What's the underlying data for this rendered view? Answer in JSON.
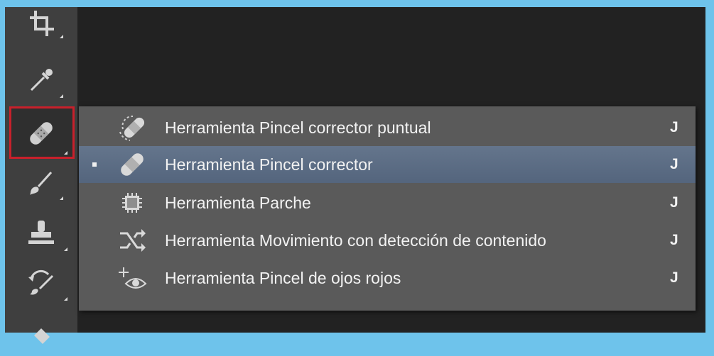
{
  "toolbar": {
    "tools": [
      {
        "name": "crop-tool"
      },
      {
        "name": "eyedropper-tool"
      },
      {
        "name": "healing-brush-tool",
        "active": true
      },
      {
        "name": "brush-tool"
      },
      {
        "name": "clone-stamp-tool"
      },
      {
        "name": "history-brush-tool"
      },
      {
        "name": "eraser-tool"
      }
    ]
  },
  "flyout": {
    "items": [
      {
        "label": "Herramienta Pincel corrector puntual",
        "shortcut": "J",
        "icon": "spot-healing-brush-icon",
        "selected": false
      },
      {
        "label": "Herramienta Pincel corrector",
        "shortcut": "J",
        "icon": "healing-brush-icon",
        "selected": true
      },
      {
        "label": "Herramienta Parche",
        "shortcut": "J",
        "icon": "patch-icon",
        "selected": false
      },
      {
        "label": "Herramienta Movimiento con detección de contenido",
        "shortcut": "J",
        "icon": "content-aware-move-icon",
        "selected": false
      },
      {
        "label": "Herramienta Pincel de ojos rojos",
        "shortcut": "J",
        "icon": "red-eye-icon",
        "selected": false
      }
    ]
  },
  "colors": {
    "frame": "#6ec3eb",
    "toolbar": "#3f3f3f",
    "canvas": "#222222",
    "flyout": "#5a5a5a",
    "selected": "#5f7088",
    "active_outline": "#c8202b"
  }
}
